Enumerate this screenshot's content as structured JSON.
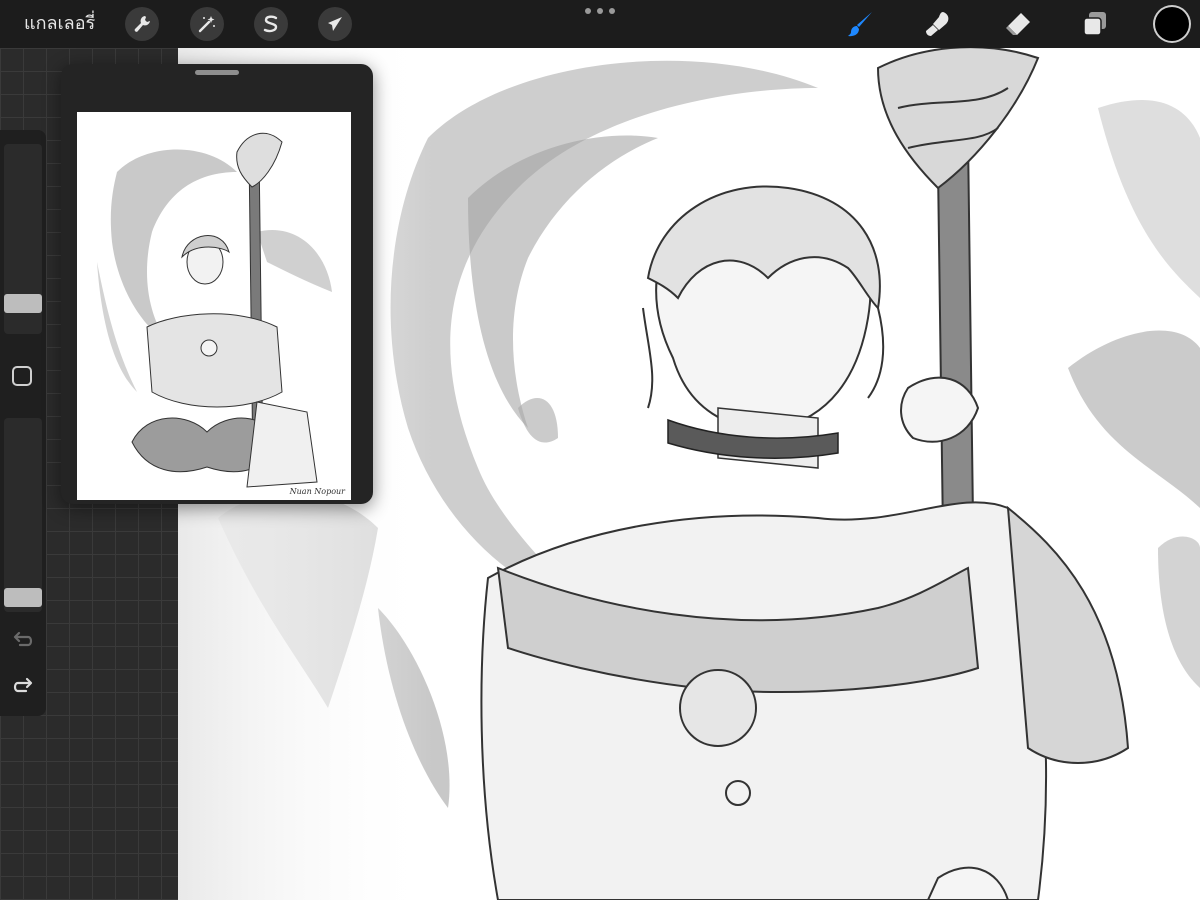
{
  "app": {
    "gallery_label": "แกลเลอรี่"
  },
  "toolbar": {
    "left_tools": [
      {
        "name": "actions",
        "icon": "wrench-icon"
      },
      {
        "name": "adjustments",
        "icon": "magic-wand-icon"
      },
      {
        "name": "selection",
        "icon": "selection-s-icon"
      },
      {
        "name": "transform",
        "icon": "arrow-cursor-icon"
      }
    ],
    "more_icon": "more-dots-icon",
    "right_tools": [
      {
        "name": "brush",
        "icon": "brush-icon",
        "active": true
      },
      {
        "name": "smudge",
        "icon": "smudge-icon",
        "active": false
      },
      {
        "name": "eraser",
        "icon": "eraser-icon",
        "active": false
      },
      {
        "name": "layers",
        "icon": "layers-icon",
        "active": false
      }
    ],
    "current_color": "#000000",
    "accent_color": "#1e88ff"
  },
  "sidebar": {
    "brush_size_level": 0.12,
    "opacity_level": 0.03,
    "modify_icon": "square-icon",
    "undo_icon": "undo-icon",
    "redo_icon": "redo-icon"
  },
  "reference": {
    "signature": "Nuan Nopour"
  }
}
